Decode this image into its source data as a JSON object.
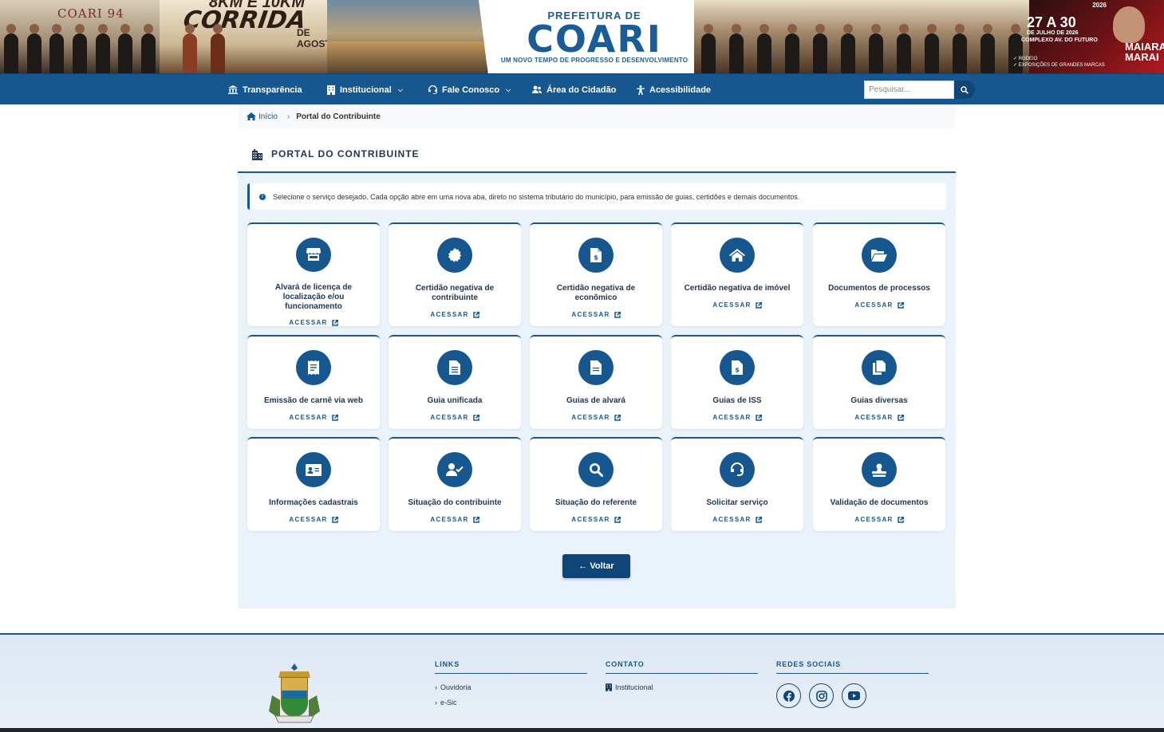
{
  "banner": {
    "left_promo": "COARI 94",
    "race_title": "CORRIDA",
    "race_top": "8KM E 10KM",
    "race_month": "DE AGOSTO",
    "logo_top": "PREFEITURA DE",
    "logo_main": "COARI",
    "logo_sub": "UM NOVO TEMPO DE PROGRESSO E DESENVOLVIMENTO",
    "event_year": "2026",
    "event_date": "27 A 30",
    "event_month": "DE JULHO DE 2026",
    "event_place": "COMPLEXO AV. DO FUTURO",
    "event_items": [
      "✓ RODEIO",
      "✓ EXPOSIÇÕES DE GRANDES MARCAS"
    ],
    "artist": "MAIARA MARAI"
  },
  "nav": {
    "items": [
      {
        "label": "Transparência",
        "icon": "bank-icon"
      },
      {
        "label": "Institucional",
        "icon": "building-icon",
        "dropdown": true
      },
      {
        "label": "Fale Conosco",
        "icon": "headset-icon",
        "dropdown": true
      },
      {
        "label": "Área do Cidadão",
        "icon": "users-icon"
      },
      {
        "label": "Acessibilidade",
        "icon": "accessibility-icon"
      }
    ],
    "search_placeholder": "Pesquisar..."
  },
  "breadcrumb": {
    "home": "Início",
    "current": "Portal do Contribuinte"
  },
  "page": {
    "title": "PORTAL DO CONTRIBUINTE",
    "info": "Selecione o serviço desejado. Cada opção abre em uma nova aba, direto no sistema tributário do município, para emissão de guias, certidões e demais documentos.",
    "action_label": "ACESSAR",
    "back_label": "← Voltar"
  },
  "cards": [
    {
      "label": "Alvará de licença de localização e/ou funcionamento",
      "icon": "store-icon"
    },
    {
      "label": "Certidão negativa de contribuinte",
      "icon": "certificate-icon"
    },
    {
      "label": "Certidão negativa de econômico",
      "icon": "invoice-dollar-icon"
    },
    {
      "label": "Certidão negativa de imóvel",
      "icon": "house-icon"
    },
    {
      "label": "Documentos de processos",
      "icon": "folder-open-icon"
    },
    {
      "label": "Emissão de carnê via web",
      "icon": "receipt-icon"
    },
    {
      "label": "Guia unificada",
      "icon": "file-lines-icon"
    },
    {
      "label": "Guias de alvará",
      "icon": "file-icon"
    },
    {
      "label": "Guias de ISS",
      "icon": "file-dollar-icon"
    },
    {
      "label": "Guias diversas",
      "icon": "copy-icon"
    },
    {
      "label": "Informações cadastrais",
      "icon": "id-card-icon"
    },
    {
      "label": "Situação do contribuinte",
      "icon": "user-check-icon"
    },
    {
      "label": "Situação do referente",
      "icon": "search-icon"
    },
    {
      "label": "Solicitar serviço",
      "icon": "headset-icon"
    },
    {
      "label": "Validação de documentos",
      "icon": "stamp-icon"
    }
  ],
  "footer": {
    "links_title": "LINKS",
    "links": [
      "Ouvidoria",
      "e-Sic"
    ],
    "contact_title": "CONTATO",
    "contact": [
      "Institucional"
    ],
    "social_title": "REDES SOCIAIS",
    "social": [
      "facebook-icon",
      "instagram-icon",
      "youtube-icon"
    ]
  },
  "colors": {
    "primary": "#16578f",
    "primary_dark": "#0f4677",
    "panel_bg": "#eaf2fb"
  }
}
